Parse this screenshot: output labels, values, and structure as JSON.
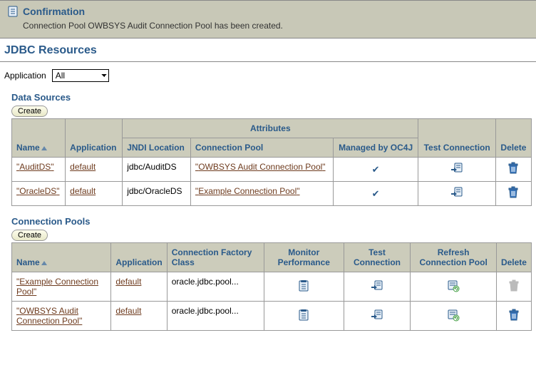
{
  "confirmation": {
    "title": "Confirmation",
    "message": "Connection Pool OWBSYS Audit Connection Pool has been created."
  },
  "page_title": "JDBC Resources",
  "application_filter": {
    "label": "Application",
    "selected": "All"
  },
  "data_sources": {
    "section_title": "Data Sources",
    "create_label": "Create",
    "group_header": "Attributes",
    "columns": {
      "name": "Name",
      "application": "Application",
      "jndi": "JNDI Location",
      "pool": "Connection Pool",
      "managed": "Managed by OC4J",
      "test": "Test Connection",
      "delete": "Delete"
    },
    "rows": [
      {
        "name": "AuditDS",
        "application": "default",
        "jndi": "jdbc/AuditDS",
        "pool": "OWBSYS Audit Connection Pool",
        "managed": true
      },
      {
        "name": "OracleDS",
        "application": "default",
        "jndi": "jdbc/OracleDS",
        "pool": "Example Connection Pool",
        "managed": true
      }
    ]
  },
  "connection_pools": {
    "section_title": "Connection Pools",
    "create_label": "Create",
    "columns": {
      "name": "Name",
      "application": "Application",
      "factory": "Connection Factory Class",
      "monitor": "Monitor Performance",
      "test": "Test Connection",
      "refresh": "Refresh Connection Pool",
      "delete": "Delete"
    },
    "rows": [
      {
        "name": "Example Connection Pool",
        "application": "default",
        "factory": "oracle.jdbc.pool...",
        "deletable": false
      },
      {
        "name": "OWBSYS Audit Connection Pool",
        "application": "default",
        "factory": "oracle.jdbc.pool...",
        "deletable": true
      }
    ]
  }
}
